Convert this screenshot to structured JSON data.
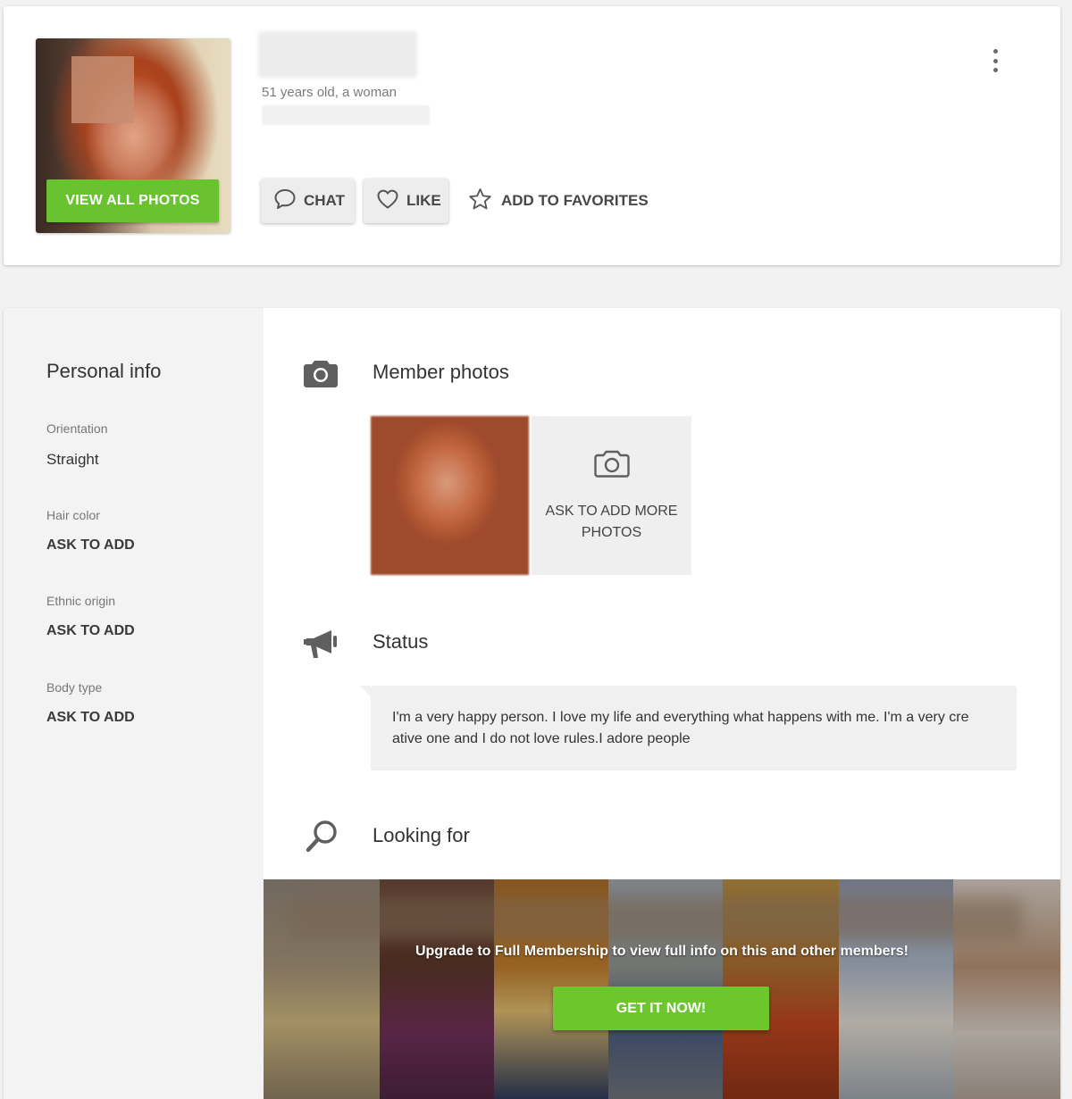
{
  "profile": {
    "age_gender": "51 years old, a woman",
    "view_photos_label": "VIEW ALL PHOTOS",
    "actions": {
      "chat_label": "CHAT",
      "like_label": "LIKE",
      "favorites_label": "ADD TO FAVORITES"
    },
    "icons": {
      "chat": "speech-bubble-icon",
      "like": "heart-icon",
      "favorites": "star-icon",
      "menu": "kebab-menu-icon"
    }
  },
  "personal_info": {
    "title": "Personal info",
    "fields": [
      {
        "label": "Orientation",
        "value": "Straight"
      },
      {
        "label": "Hair color",
        "value": "ASK TO ADD"
      },
      {
        "label": "Ethnic origin",
        "value": "ASK TO ADD"
      },
      {
        "label": "Body type",
        "value": "ASK TO ADD"
      }
    ]
  },
  "sections": {
    "photos": {
      "title": "Member photos",
      "icon": "camera-icon",
      "ask_more_label": "ASK TO ADD MORE PHOTOS"
    },
    "status": {
      "title": "Status",
      "icon": "megaphone-icon",
      "text": "I'm a very happy person. I love my life and everything what happens with me. I'm a very cre ative one and I do not love rules.I adore people"
    },
    "looking_for": {
      "title": "Looking for",
      "icon": "search-icon"
    }
  },
  "upgrade": {
    "message": "Upgrade to Full Membership to view full info on this and other members!",
    "button_label": "GET IT NOW!"
  },
  "colors": {
    "accent_green": "#68c32f",
    "sidebar_bg": "#f3f3f3",
    "page_bg": "#f2f2f2"
  }
}
